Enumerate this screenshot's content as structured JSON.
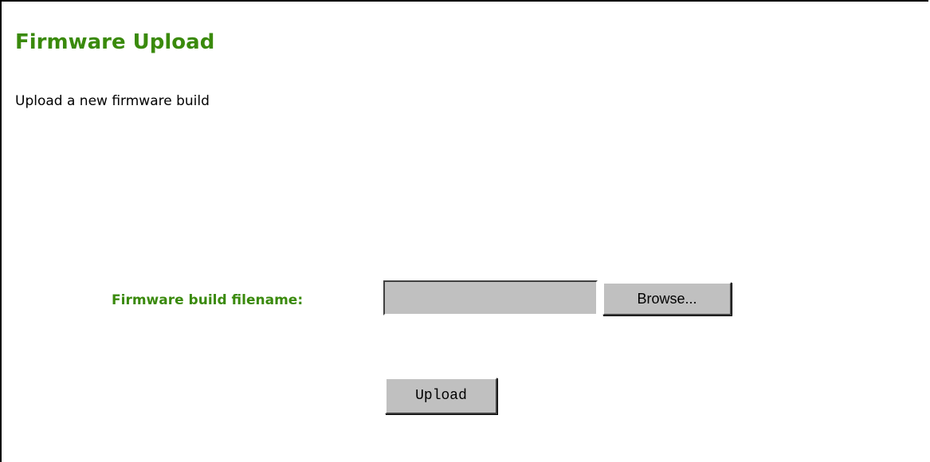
{
  "page": {
    "title": "Firmware Upload",
    "subtitle": "Upload a new firmware build"
  },
  "form": {
    "filename_label": "Firmware build filename:",
    "filename_value": "",
    "browse_label": "Browse...",
    "upload_label": "Upload"
  },
  "colors": {
    "accent": "#3a8a0c",
    "button_face": "#c0c0c0",
    "background": "#ffffff"
  }
}
